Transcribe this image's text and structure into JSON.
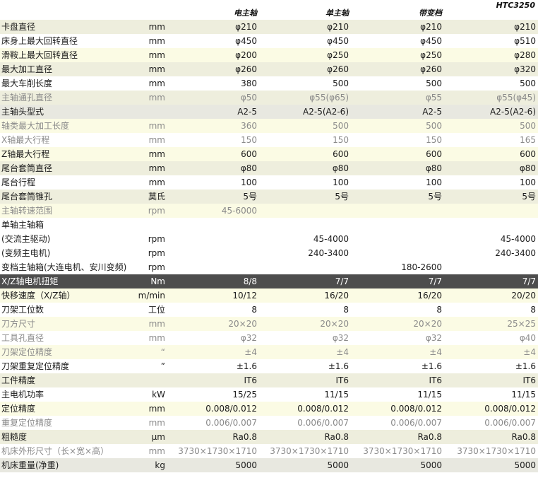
{
  "header": {
    "cols": [
      "电主轴",
      "单主轴",
      "带变档"
    ],
    "model": "HTC3250"
  },
  "rows": [
    {
      "name": "卡盘直径",
      "unit": "mm",
      "v": [
        "φ210",
        "φ210",
        "φ210",
        "φ210"
      ],
      "style": "bg-a",
      "dim": false
    },
    {
      "name": "床身上最大回转直径",
      "unit": "mm",
      "v": [
        "φ450",
        "φ450",
        "φ450",
        "φ510"
      ],
      "style": "bg-b",
      "dim": false
    },
    {
      "name": "滑鞍上最大回转直径",
      "unit": "mm",
      "v": [
        "φ200",
        "φ250",
        "φ250",
        "φ280"
      ],
      "style": "bg-c",
      "dim": false
    },
    {
      "name": "最大加工直径",
      "unit": "mm",
      "v": [
        "φ260",
        "φ260",
        "φ260",
        "φ320"
      ],
      "style": "bg-a",
      "dim": false
    },
    {
      "name": "最大车削长度",
      "unit": "mm",
      "v": [
        "380",
        "500",
        "500",
        "500"
      ],
      "style": "bg-b",
      "dim": false
    },
    {
      "name": "主轴通孔直径",
      "unit": "mm",
      "v": [
        "φ50",
        "φ55(φ65)",
        "φ55",
        "φ55(φ45)"
      ],
      "style": "bg-a",
      "dim": true
    },
    {
      "name": "主轴头型式",
      "unit": "",
      "v": [
        "A2-5",
        "A2-5(A2-6)",
        "A2-5",
        "A2-5(A2-6)"
      ],
      "style": "bg-d",
      "dim": false
    },
    {
      "name": "轴类最大加工长度",
      "unit": "mm",
      "v": [
        "360",
        "500",
        "500",
        "500"
      ],
      "style": "bg-c",
      "dim": true
    },
    {
      "name": "X轴最大行程",
      "unit": "mm",
      "v": [
        "150",
        "150",
        "150",
        "165"
      ],
      "style": "bg-b",
      "dim": true
    },
    {
      "name": "Z轴最大行程",
      "unit": "mm",
      "v": [
        "600",
        "600",
        "600",
        "600"
      ],
      "style": "bg-c",
      "dim": false
    },
    {
      "name": "尾台套筒直径",
      "unit": "mm",
      "v": [
        "φ80",
        "φ80",
        "φ80",
        "φ80"
      ],
      "style": "bg-a",
      "dim": false
    },
    {
      "name": "尾台行程",
      "unit": "mm",
      "v": [
        "100",
        "100",
        "100",
        "100"
      ],
      "style": "bg-b",
      "dim": false
    },
    {
      "name": "尾台套筒锥孔",
      "unit": "莫氏",
      "v": [
        "5号",
        "5号",
        "5号",
        "5号"
      ],
      "style": "bg-a",
      "dim": false
    },
    {
      "name": "主轴转速范围",
      "unit": "rpm",
      "v": [
        "45-6000",
        "",
        "",
        ""
      ],
      "style": "bg-c",
      "dim": true
    },
    {
      "name": "单轴主轴箱",
      "unit": "",
      "v": [
        "",
        "",
        "",
        ""
      ],
      "style": "bg-b",
      "dim": false
    },
    {
      "name": "(交流主驱动)",
      "unit": "rpm",
      "v": [
        "",
        "45-4000",
        "",
        "45-4000"
      ],
      "style": "bg-b",
      "dim": false
    },
    {
      "name": "(变频主电机)",
      "unit": "rpm",
      "v": [
        "",
        "240-3400",
        "",
        "240-3400"
      ],
      "style": "bg-b",
      "dim": false
    },
    {
      "name": "变档主轴箱(大连电机、安川变频)",
      "unit": "rpm",
      "v": [
        "",
        "",
        "180-2600",
        ""
      ],
      "style": "bg-b",
      "dim": false
    },
    {
      "name": "X/Z轴电机扭矩",
      "unit": "Nm",
      "v": [
        "8/8",
        "7/7",
        "7/7",
        "7/7"
      ],
      "style": "bg-dark",
      "dim": false
    },
    {
      "name": "快移速度（X/Z轴）",
      "unit": "m/min",
      "v": [
        "10/12",
        "16/20",
        "16/20",
        "20/20"
      ],
      "style": "bg-c",
      "dim": false
    },
    {
      "name": "刀架工位数",
      "unit": "工位",
      "v": [
        "8",
        "8",
        "8",
        "8"
      ],
      "style": "bg-b",
      "dim": false
    },
    {
      "name": "刀方尺寸",
      "unit": "mm",
      "v": [
        "20×20",
        "20×20",
        "20×20",
        "25×25"
      ],
      "style": "bg-c",
      "dim": true
    },
    {
      "name": "工具孔直径",
      "unit": "mm",
      "v": [
        "φ32",
        "φ32",
        "φ32",
        "φ40"
      ],
      "style": "bg-b",
      "dim": true
    },
    {
      "name": "刀架定位精度",
      "unit": "“",
      "v": [
        "±4",
        "±4",
        "±4",
        "±4"
      ],
      "style": "bg-c",
      "dim": true
    },
    {
      "name": "刀架重复定位精度",
      "unit": "”",
      "v": [
        "±1.6",
        "±1.6",
        "±1.6",
        "±1.6"
      ],
      "style": "bg-b",
      "dim": false
    },
    {
      "name": "工件精度",
      "unit": "",
      "v": [
        "IT6",
        "IT6",
        "IT6",
        "IT6"
      ],
      "style": "bg-a",
      "dim": false
    },
    {
      "name": "主电机功率",
      "unit": "kW",
      "v": [
        "15/25",
        "11/15",
        "11/15",
        "11/15"
      ],
      "style": "bg-b",
      "dim": false
    },
    {
      "name": "定位精度",
      "unit": "mm",
      "v": [
        "0.008/0.012",
        "0.008/0.012",
        "0.008/0.012",
        "0.008/0.012"
      ],
      "style": "bg-c",
      "dim": false
    },
    {
      "name": "重复定位精度",
      "unit": "mm",
      "v": [
        "0.006/0.007",
        "0.006/0.007",
        "0.006/0.007",
        "0.006/0.007"
      ],
      "style": "bg-b",
      "dim": true
    },
    {
      "name": "粗糙度",
      "unit": "μm",
      "v": [
        "Ra0.8",
        "Ra0.8",
        "Ra0.8",
        "Ra0.8"
      ],
      "style": "bg-a",
      "dim": false
    },
    {
      "name": "机床外形尺寸（长×宽×高）",
      "unit": "mm",
      "v": [
        "3730×1730×1710",
        "3730×1730×1710",
        "3730×1730×1710",
        "3730×1730×1710"
      ],
      "style": "bg-b",
      "dim": true
    },
    {
      "name": "机床重量(净重)",
      "unit": "kg",
      "v": [
        "5000",
        "5000",
        "5000",
        "5000"
      ],
      "style": "bg-d",
      "dim": false
    }
  ]
}
